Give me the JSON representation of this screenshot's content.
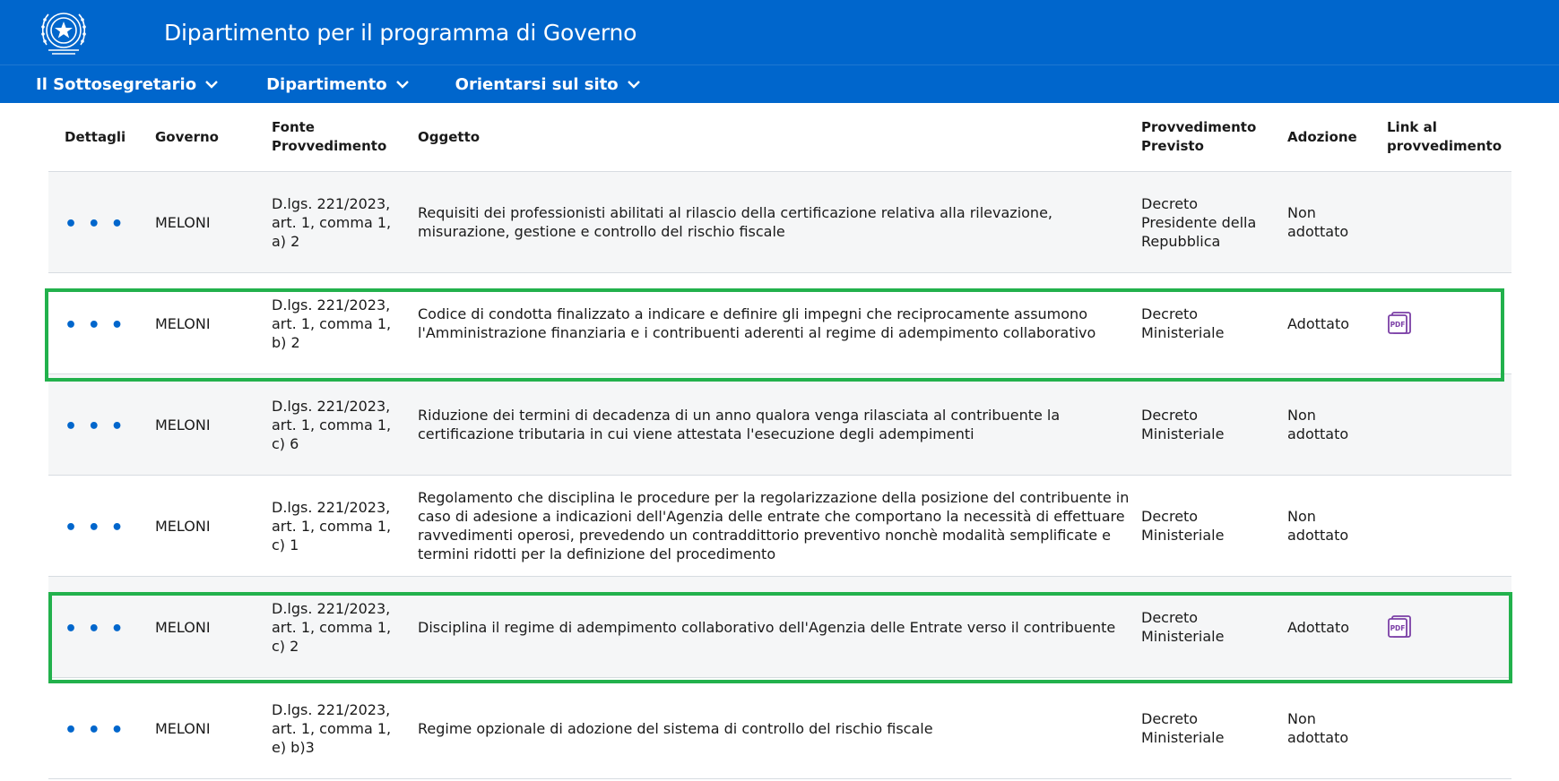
{
  "header": {
    "title": "Dipartimento per il programma di Governo",
    "emblem": "repubblica-italiana-emblem"
  },
  "nav": [
    {
      "label": "Il Sottosegretario"
    },
    {
      "label": "Dipartimento"
    },
    {
      "label": "Orientarsi sul sito"
    }
  ],
  "table": {
    "headers": {
      "dettagli": "Dettagli",
      "governo": "Governo",
      "fonte": "Fonte Provvedimento",
      "oggetto": "Oggetto",
      "provvedimento": "Provvedimento Previsto",
      "adozione": "Adozione",
      "link": "Link al provvedimento"
    },
    "rows": [
      {
        "dettagli": "• • •",
        "governo": "MELONI",
        "fonte": "D.lgs. 221/2023, art. 1, comma 1, a) 2",
        "oggetto": "Requisiti dei professionisti abilitati al rilascio della certificazione relativa alla rilevazione, misurazione, gestione e controllo del rischio fiscale",
        "provvedimento": "Decreto Presidente della Repubblica",
        "adozione": "Non adottato",
        "has_pdf": false
      },
      {
        "dettagli": "• • •",
        "governo": "MELONI",
        "fonte": "D.lgs. 221/2023, art. 1, comma 1, b) 2",
        "oggetto": "Codice di condotta finalizzato a indicare e definire gli impegni che reciprocamente assumono l'Amministrazione finanziaria e i contribuenti aderenti al regime di adempimento collaborativo",
        "provvedimento": "Decreto Ministeriale",
        "adozione": "Adottato",
        "has_pdf": true,
        "pdf_label": "PDF"
      },
      {
        "dettagli": "• • •",
        "governo": "MELONI",
        "fonte": "D.lgs. 221/2023, art. 1, comma 1, c) 6",
        "oggetto": "Riduzione dei termini di decadenza di un anno qualora venga rilasciata al contribuente la certificazione tributaria in cui viene attestata l'esecuzione degli adempimenti",
        "provvedimento": "Decreto Ministeriale",
        "adozione": "Non adottato",
        "has_pdf": false
      },
      {
        "dettagli": "• • •",
        "governo": "MELONI",
        "fonte": "D.lgs. 221/2023, art. 1, comma 1, c) 1",
        "oggetto": "Regolamento che disciplina le procedure per la regolarizzazione della posizione del contribuente in caso di adesione a indicazioni dell'Agenzia delle entrate che comportano la necessità di effettuare ravvedimenti operosi, prevedendo un contraddittorio preventivo nonchè modalità semplificate e termini ridotti per la definizione del procedimento",
        "provvedimento": "Decreto Ministeriale",
        "adozione": "Non adottato",
        "has_pdf": false
      },
      {
        "dettagli": "• • •",
        "governo": "MELONI",
        "fonte": "D.lgs. 221/2023, art. 1, comma 1, c) 2",
        "oggetto": "Disciplina il regime di adempimento collaborativo dell'Agenzia delle Entrate verso il contribuente",
        "provvedimento": "Decreto Ministeriale",
        "adozione": "Adottato",
        "has_pdf": true,
        "pdf_label": "PDF"
      },
      {
        "dettagli": "• • •",
        "governo": "MELONI",
        "fonte": "D.lgs. 221/2023, art. 1, comma 1, e) b)3",
        "oggetto": "Regime opzionale di adozione del sistema di controllo del rischio fiscale",
        "provvedimento": "Decreto Ministeriale",
        "adozione": "Non adottato",
        "has_pdf": false
      }
    ]
  },
  "colors": {
    "brand_blue": "#0066cc",
    "highlight_green": "#22b14c",
    "pdf_purple": "#7b3fa6",
    "row_alt": "#f5f6f7"
  }
}
